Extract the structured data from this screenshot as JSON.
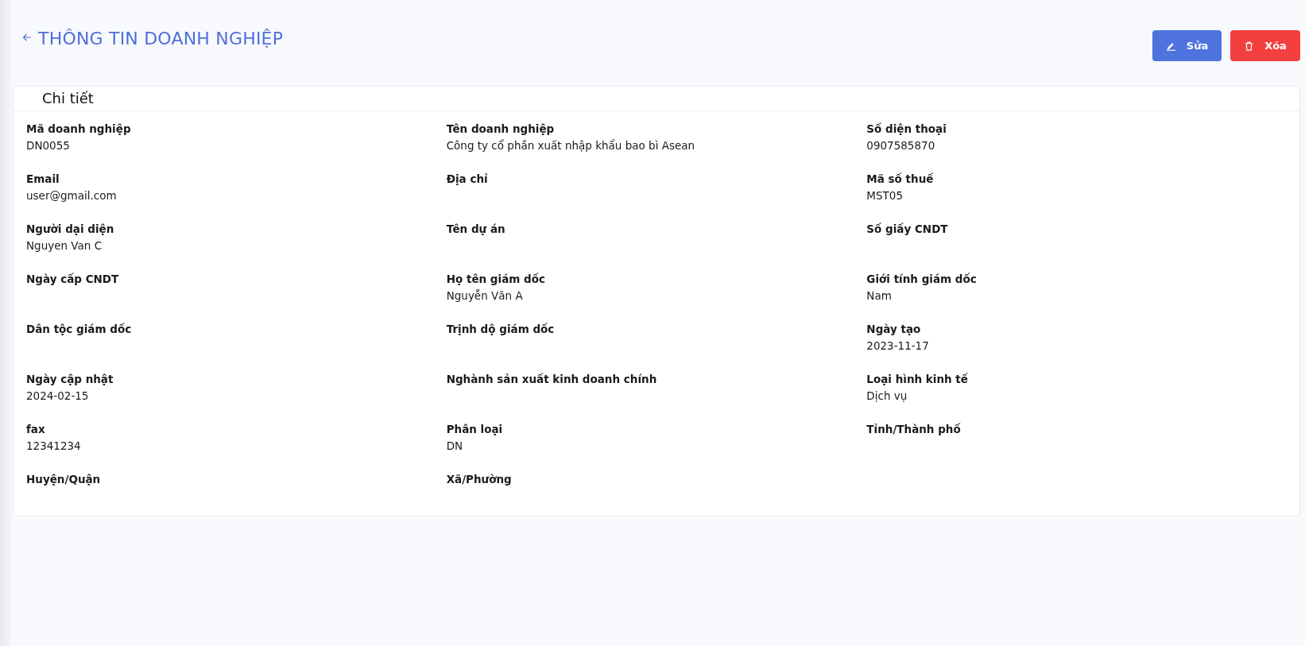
{
  "header": {
    "title": "THÔNG TIN DOANH NGHIỆP",
    "buttons": [
      {
        "kind": "edit",
        "label": "Sửa"
      },
      {
        "kind": "delete",
        "label": "Xóa"
      }
    ]
  },
  "card": {
    "title": "Chi tiết",
    "fields": [
      {
        "label": "Mã doanh nghiệp",
        "value": "DN0055"
      },
      {
        "label": "Tên doanh nghiệp",
        "value": "Công ty cổ phần xuất nhập khẩu bao bì Asean"
      },
      {
        "label": "Số diện thoại",
        "value": "0907585870"
      },
      {
        "label": "Email",
        "value": "user@gmail.com"
      },
      {
        "label": "Địa chỉ"
      },
      {
        "label": "Mã số thuế",
        "value": "MST05"
      },
      {
        "label": "Người dại diện",
        "value": "Nguyen Van C"
      },
      {
        "label": "Tên dự án"
      },
      {
        "label": "Số giấy CNDT"
      },
      {
        "label": "Ngày cấp CNDT"
      },
      {
        "label": "Họ tên giám dốc",
        "value": "Nguyễn Văn A"
      },
      {
        "label": "Giới tính giám dốc",
        "value": "Nam"
      },
      {
        "label": "Dân tộc giám dốc"
      },
      {
        "label": "Trịnh dộ giám dốc"
      },
      {
        "label": "Ngày tạo",
        "value": "2023-11-17"
      },
      {
        "label": "Ngày cập nhật",
        "value": "2024-02-15"
      },
      {
        "label": "Nghành sản xuất kinh doanh chính"
      },
      {
        "label": "Loại hình kinh tế",
        "value": "Dịch vụ"
      },
      {
        "label": "fax",
        "value": "12341234"
      },
      {
        "label": "Phân loại",
        "value": "DN"
      },
      {
        "label": "Tỉnh/Thành phố"
      },
      {
        "label": "Huyện/Quận"
      },
      {
        "label": "Xã/Phường"
      }
    ]
  }
}
